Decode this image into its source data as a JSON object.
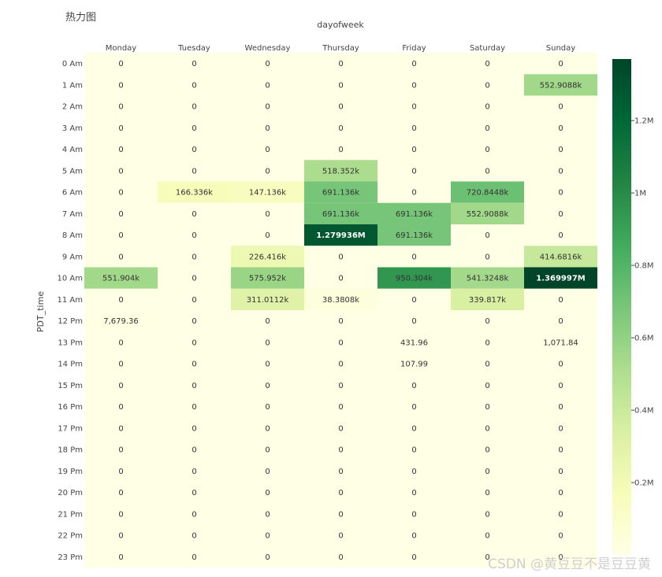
{
  "chart_data": {
    "type": "heatmap",
    "title": "热力图",
    "xlabel": "dayofweek",
    "ylabel": "PDT_time",
    "x_position": "top",
    "x": [
      "Monday",
      "Tuesday",
      "Wednesday",
      "Thursday",
      "Friday",
      "Saturday",
      "Sunday"
    ],
    "y": [
      "0 Am",
      "1 Am",
      "2 Am",
      "3 Am",
      "4 Am",
      "5 Am",
      "6 Am",
      "7 Am",
      "8 Am",
      "9 Am",
      "10 Am",
      "11 Am",
      "12 Pm",
      "13 Pm",
      "14 Pm",
      "15 Pm",
      "16 Pm",
      "17 Pm",
      "18 Pm",
      "19 Pm",
      "20 Pm",
      "21 Pm",
      "22 Pm",
      "23 Pm"
    ],
    "z": [
      [
        0,
        0,
        0,
        0,
        0,
        0,
        0
      ],
      [
        0,
        0,
        0,
        0,
        0,
        0,
        552908.8
      ],
      [
        0,
        0,
        0,
        0,
        0,
        0,
        0
      ],
      [
        0,
        0,
        0,
        0,
        0,
        0,
        0
      ],
      [
        0,
        0,
        0,
        0,
        0,
        0,
        0
      ],
      [
        0,
        0,
        0,
        518352,
        0,
        0,
        0
      ],
      [
        0,
        166336,
        147136,
        691136,
        0,
        720844.8,
        0
      ],
      [
        0,
        0,
        0,
        691136,
        691136,
        552908.8,
        0
      ],
      [
        0,
        0,
        0,
        1279936,
        691136,
        0,
        0
      ],
      [
        0,
        0,
        226416,
        0,
        0,
        0,
        414681.6
      ],
      [
        551904,
        0,
        575952,
        0,
        950304,
        541324.8,
        1369997
      ],
      [
        0,
        0,
        311011.2,
        38380.8,
        0,
        339817,
        0
      ],
      [
        7679.36,
        0,
        0,
        0,
        0,
        0,
        0
      ],
      [
        0,
        0,
        0,
        0,
        431.96,
        0,
        1071.84
      ],
      [
        0,
        0,
        0,
        0,
        107.99,
        0,
        0
      ],
      [
        0,
        0,
        0,
        0,
        0,
        0,
        0
      ],
      [
        0,
        0,
        0,
        0,
        0,
        0,
        0
      ],
      [
        0,
        0,
        0,
        0,
        0,
        0,
        0
      ],
      [
        0,
        0,
        0,
        0,
        0,
        0,
        0
      ],
      [
        0,
        0,
        0,
        0,
        0,
        0,
        0
      ],
      [
        0,
        0,
        0,
        0,
        0,
        0,
        0
      ],
      [
        0,
        0,
        0,
        0,
        0,
        0,
        0
      ],
      [
        0,
        0,
        0,
        0,
        0,
        0,
        0
      ],
      [
        0,
        0,
        0,
        0,
        0,
        0,
        0
      ]
    ],
    "text": [
      [
        "0",
        "0",
        "0",
        "0",
        "0",
        "0",
        "0"
      ],
      [
        "0",
        "0",
        "0",
        "0",
        "0",
        "0",
        "552.9088k"
      ],
      [
        "0",
        "0",
        "0",
        "0",
        "0",
        "0",
        "0"
      ],
      [
        "0",
        "0",
        "0",
        "0",
        "0",
        "0",
        "0"
      ],
      [
        "0",
        "0",
        "0",
        "0",
        "0",
        "0",
        "0"
      ],
      [
        "0",
        "0",
        "0",
        "518.352k",
        "0",
        "0",
        "0"
      ],
      [
        "0",
        "166.336k",
        "147.136k",
        "691.136k",
        "0",
        "720.8448k",
        "0"
      ],
      [
        "0",
        "0",
        "0",
        "691.136k",
        "691.136k",
        "552.9088k",
        "0"
      ],
      [
        "0",
        "0",
        "0",
        "1.279936M",
        "691.136k",
        "0",
        "0"
      ],
      [
        "0",
        "0",
        "226.416k",
        "0",
        "0",
        "0",
        "414.6816k"
      ],
      [
        "551.904k",
        "0",
        "575.952k",
        "0",
        "950.304k",
        "541.3248k",
        "1.369997M"
      ],
      [
        "0",
        "0",
        "311.0112k",
        "38.3808k",
        "0",
        "339.817k",
        "0"
      ],
      [
        "7,679.36",
        "0",
        "0",
        "0",
        "0",
        "0",
        "0"
      ],
      [
        "0",
        "0",
        "0",
        "0",
        "431.96",
        "0",
        "1,071.84"
      ],
      [
        "0",
        "0",
        "0",
        "0",
        "107.99",
        "0",
        "0"
      ],
      [
        "0",
        "0",
        "0",
        "0",
        "0",
        "0",
        "0"
      ],
      [
        "0",
        "0",
        "0",
        "0",
        "0",
        "0",
        "0"
      ],
      [
        "0",
        "0",
        "0",
        "0",
        "0",
        "0",
        "0"
      ],
      [
        "0",
        "0",
        "0",
        "0",
        "0",
        "0",
        "0"
      ],
      [
        "0",
        "0",
        "0",
        "0",
        "0",
        "0",
        "0"
      ],
      [
        "0",
        "0",
        "0",
        "0",
        "0",
        "0",
        "0"
      ],
      [
        "0",
        "0",
        "0",
        "0",
        "0",
        "0",
        "0"
      ],
      [
        "0",
        "0",
        "0",
        "0",
        "0",
        "0",
        "0"
      ],
      [
        "0",
        "0",
        "0",
        "0",
        "0",
        "0",
        "0"
      ]
    ],
    "zmin": 0,
    "zmax": 1369997,
    "colorscale": "YlGn",
    "colorscale_stops": [
      "#ffffe5",
      "#f7fcb9",
      "#d9f0a3",
      "#addd8e",
      "#78c679",
      "#41ab5d",
      "#238443",
      "#006837",
      "#004529"
    ],
    "colorbar": {
      "ticks": [
        200000,
        400000,
        600000,
        800000,
        1000000,
        1200000
      ],
      "ticktext": [
        "0.2M",
        "0.4M",
        "0.6M",
        "0.8M",
        "1M",
        "1.2M"
      ]
    },
    "grid": false,
    "legend": "colorbar-right"
  },
  "watermark": "CSDN @黄豆豆不是豆豆黄"
}
